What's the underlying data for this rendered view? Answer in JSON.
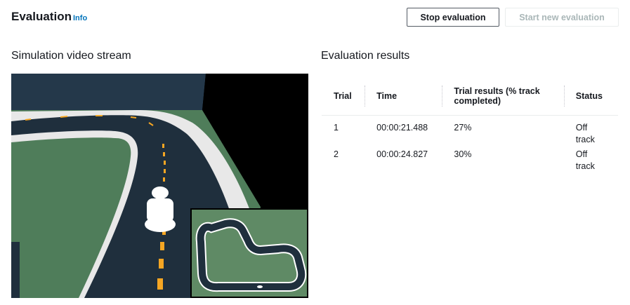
{
  "header": {
    "title": "Evaluation",
    "info": "Info",
    "stop_button": "Stop evaluation",
    "start_button": "Start new evaluation"
  },
  "simulation": {
    "title": "Simulation video stream"
  },
  "results": {
    "title": "Evaluation results",
    "columns": [
      "Trial",
      "Time",
      "Trial results (% track completed)",
      "Status"
    ],
    "rows": [
      {
        "trial": "1",
        "time": "00:00:21.488",
        "result": "27%",
        "status": "Off track"
      },
      {
        "trial": "2",
        "time": "00:00:24.827",
        "result": "30%",
        "status": "Off track"
      }
    ]
  },
  "colors": {
    "accent_link": "#0073bb",
    "track_surface": "#1f2f3d",
    "grass": "#4f7d5a",
    "lane_marker": "#f5a623"
  }
}
